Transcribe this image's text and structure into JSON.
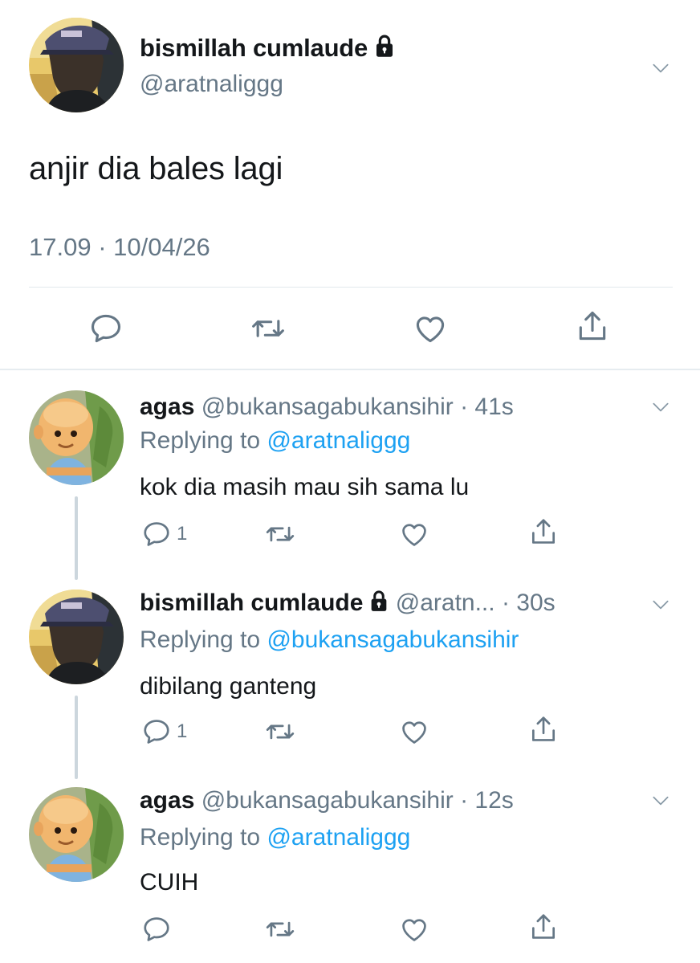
{
  "main": {
    "name": "bismillah cumlaude",
    "handle": "@aratnaliggg",
    "text": "anjir dia bales lagi",
    "timestamp": "17.09 · 10/04/26",
    "icons": [
      "reply-icon",
      "retweet-icon",
      "like-icon",
      "share-icon"
    ]
  },
  "replies": [
    {
      "name": "agas",
      "handle": "@bukansagabukansihir",
      "time": "· 41s",
      "replying_prefix": "Replying to ",
      "replying_to": "@aratnaliggg",
      "text": "kok dia masih mau sih sama lu",
      "reply_count": "1",
      "locked": false
    },
    {
      "name": "bismillah cumlaude",
      "handle": "@aratn...",
      "time": "· 30s",
      "replying_prefix": "Replying to ",
      "replying_to": "@bukansagabukansihir",
      "text": "dibilang ganteng",
      "reply_count": "1",
      "locked": true
    },
    {
      "name": "agas",
      "handle": "@bukansagabukansihir",
      "time": "· 12s",
      "replying_prefix": "Replying to ",
      "replying_to": "@aratnaliggg",
      "text": "CUIH",
      "reply_count": "",
      "locked": false
    }
  ],
  "colors": {
    "text": "#14171a",
    "secondary": "#657786",
    "mention": "#1da1f2",
    "divider": "#e1e8ed",
    "thread_line": "#ccd6dd"
  }
}
